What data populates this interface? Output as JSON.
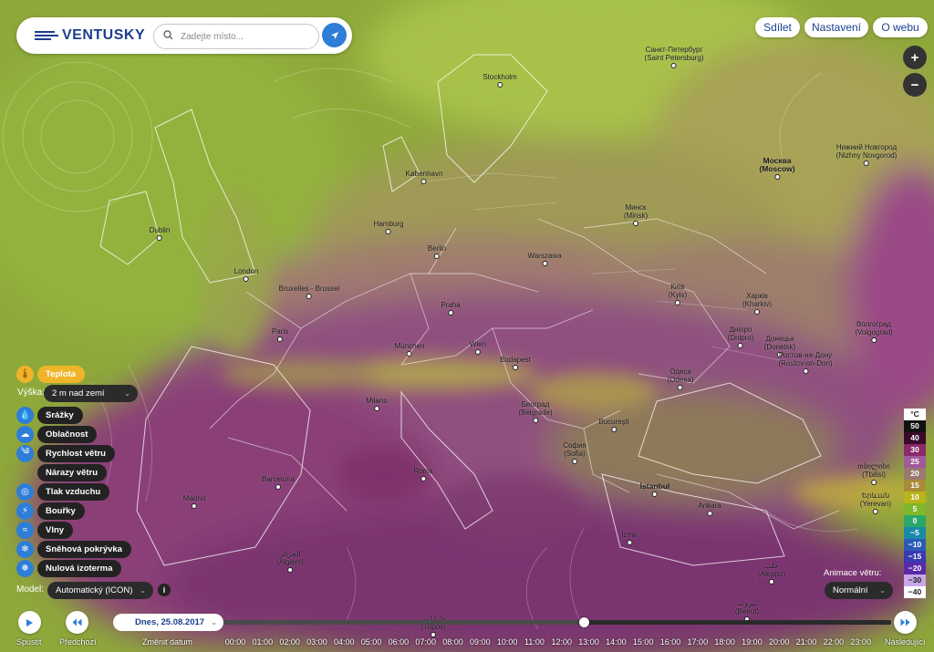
{
  "brand": {
    "name": "VENTUSKY"
  },
  "search": {
    "placeholder": "Zadejte místo..."
  },
  "icons": {
    "search": "search-icon",
    "locate": "location-arrow-icon",
    "play": "play-icon",
    "prev": "rewind-icon",
    "next": "fast-forward-icon",
    "info": "info-icon"
  },
  "top_nav": {
    "share": "Sdílet",
    "settings": "Nastavení",
    "about": "O webu"
  },
  "zoom": {
    "in": "+",
    "out": "−"
  },
  "layers": [
    {
      "label": "Teplota",
      "icon": "thermometer-icon",
      "glyph": "🌡",
      "active": true
    },
    {
      "label": "Srážky",
      "icon": "raindrop-icon",
      "glyph": "💧",
      "active": false
    },
    {
      "label": "Oblačnost",
      "icon": "cloud-icon",
      "glyph": "☁",
      "active": false
    },
    {
      "label": "Rychlost větru",
      "icon": "wind-icon",
      "glyph": "༄",
      "active": false
    },
    {
      "label": "Nárazy větru",
      "icon": "",
      "glyph": "",
      "active": false
    },
    {
      "label": "Tlak vzduchu",
      "icon": "pressure-icon",
      "glyph": "◎",
      "active": false
    },
    {
      "label": "Bouřky",
      "icon": "lightning-icon",
      "glyph": "⚡",
      "active": false
    },
    {
      "label": "Vlny",
      "icon": "wave-icon",
      "glyph": "≈",
      "active": false
    },
    {
      "label": "Sněhová pokrývka",
      "icon": "snowflake-icon",
      "glyph": "❄",
      "active": false
    },
    {
      "label": "Nulová izoterma",
      "icon": "isotherm-icon",
      "glyph": "❅",
      "active": false
    }
  ],
  "height": {
    "label": "Výška:",
    "value": "2 m nad zemí"
  },
  "model": {
    "label": "Model:",
    "value": "Automatický (ICON)"
  },
  "animation": {
    "label": "Animace větru:",
    "value": "Normální"
  },
  "legend": {
    "unit": "°C",
    "rows": [
      {
        "v": "50",
        "color": "#111111"
      },
      {
        "v": "40",
        "color": "#3a0a2a"
      },
      {
        "v": "30",
        "color": "#8a2a6a"
      },
      {
        "v": "25",
        "color": "#a15a9a"
      },
      {
        "v": "20",
        "color": "#9a7a70"
      },
      {
        "v": "15",
        "color": "#a88b3a"
      },
      {
        "v": "10",
        "color": "#b8b41a"
      },
      {
        "v": "5",
        "color": "#7fb82a"
      },
      {
        "v": "0",
        "color": "#2aa86a"
      },
      {
        "v": "−5",
        "color": "#1a8aa8"
      },
      {
        "v": "−10",
        "color": "#2a5ab8"
      },
      {
        "v": "−15",
        "color": "#3a3ab0"
      },
      {
        "v": "−20",
        "color": "#5a2aa8"
      },
      {
        "v": "−30",
        "color": "#c8a8e8"
      },
      {
        "v": "−40",
        "color": "#ffffff"
      }
    ]
  },
  "timeline": {
    "play": "Spustit",
    "prev": "Předchozí",
    "next": "Následující",
    "date": "Dnes, 25.08.2017",
    "change_date": "Změnit datum",
    "progress": 0.54,
    "hours": [
      "00:00",
      "01:00",
      "02:00",
      "03:00",
      "04:00",
      "05:00",
      "06:00",
      "07:00",
      "08:00",
      "09:00",
      "10:00",
      "11:00",
      "12:00",
      "13:00",
      "14:00",
      "15:00",
      "16:00",
      "17:00",
      "18:00",
      "19:00",
      "20:00",
      "21:00",
      "22:00",
      "23:00"
    ]
  },
  "cities": [
    {
      "name": "Санкт-Петербург",
      "sub": "(Saint Petersburg)",
      "capital": false
    },
    {
      "name": "Stockholm",
      "sub": "",
      "capital": false
    },
    {
      "name": "Нижний Новгород",
      "sub": "(Nizhny Novgorod)",
      "capital": false
    },
    {
      "name": "Москва",
      "sub": "(Moscow)",
      "capital": true
    },
    {
      "name": "København",
      "sub": "",
      "capital": false
    },
    {
      "name": "Dublin",
      "sub": "",
      "capital": false
    },
    {
      "name": "Hamburg",
      "sub": "",
      "capital": false
    },
    {
      "name": "Минск",
      "sub": "(Minsk)",
      "capital": false
    },
    {
      "name": "Berlin",
      "sub": "",
      "capital": false
    },
    {
      "name": "Warszawa",
      "sub": "",
      "capital": false
    },
    {
      "name": "London",
      "sub": "",
      "capital": false
    },
    {
      "name": "Bruxelles - Brussel",
      "sub": "",
      "capital": false
    },
    {
      "name": "Київ",
      "sub": "(Kyiv)",
      "capital": false
    },
    {
      "name": "Харків",
      "sub": "(Kharkiv)",
      "capital": false
    },
    {
      "name": "Praha",
      "sub": "",
      "capital": false
    },
    {
      "name": "Paris",
      "sub": "",
      "capital": false
    },
    {
      "name": "Дніпро",
      "sub": "(Dnipro)",
      "capital": false
    },
    {
      "name": "Донецьк",
      "sub": "(Donetsk)",
      "capital": false
    },
    {
      "name": "Волгоград",
      "sub": "(Volgograd)",
      "capital": false
    },
    {
      "name": "München",
      "sub": "",
      "capital": false
    },
    {
      "name": "Wien",
      "sub": "",
      "capital": false
    },
    {
      "name": "Ростов-на-Дону",
      "sub": "(Rostov-on-Don)",
      "capital": false
    },
    {
      "name": "Budapest",
      "sub": "",
      "capital": false
    },
    {
      "name": "Одеса",
      "sub": "(Odesa)",
      "capital": false
    },
    {
      "name": "Milano",
      "sub": "",
      "capital": false
    },
    {
      "name": "Београд",
      "sub": "(Belgrade)",
      "capital": false
    },
    {
      "name": "București",
      "sub": "",
      "capital": false
    },
    {
      "name": "София",
      "sub": "(Sofia)",
      "capital": false
    },
    {
      "name": "თბილისი",
      "sub": "(Tbilisi)",
      "capital": false
    },
    {
      "name": "Barcelona",
      "sub": "",
      "capital": false
    },
    {
      "name": "Roma",
      "sub": "",
      "capital": false
    },
    {
      "name": "İstanbul",
      "sub": "",
      "capital": true
    },
    {
      "name": "Երևան",
      "sub": "(Yerevan)",
      "capital": false
    },
    {
      "name": "Madrid",
      "sub": "",
      "capital": false
    },
    {
      "name": "Ankara",
      "sub": "",
      "capital": false
    },
    {
      "name": "İzmir",
      "sub": "",
      "capital": false
    },
    {
      "name": "الجزائر",
      "sub": "(Algiers)",
      "capital": false
    },
    {
      "name": "حلب",
      "sub": "(Aleppo)",
      "capital": false
    },
    {
      "name": "بيروت",
      "sub": "(Beirut)",
      "capital": false
    },
    {
      "name": "طرابلس",
      "sub": "(Tripoli)",
      "capital": false
    }
  ]
}
